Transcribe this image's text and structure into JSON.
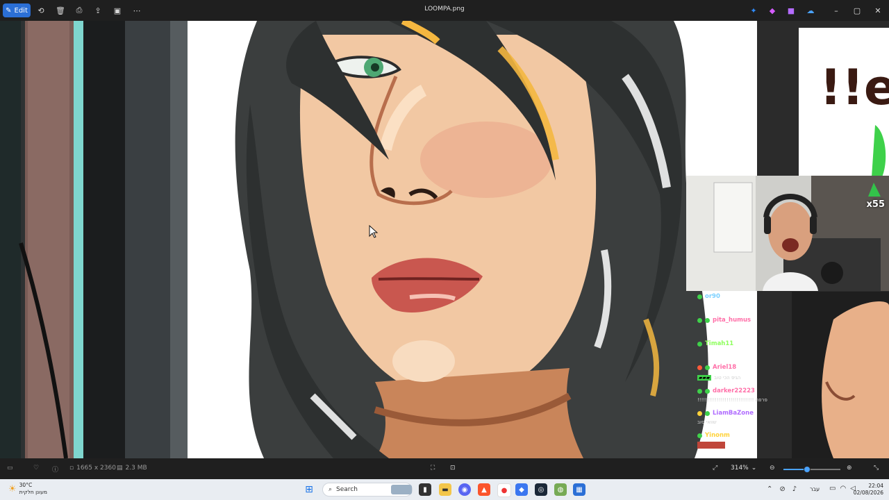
{
  "window": {
    "title": "LOOMPA.png",
    "edit_label": "Edit",
    "toolbar_icons": [
      "rotate-icon",
      "delete-icon",
      "print-icon",
      "share-icon",
      "slideshow-icon",
      "more-icon"
    ]
  },
  "overlay": {
    "streak_badge": "x55",
    "chat": [
      {
        "user": "or90",
        "color": "#7ad0ff",
        "text": ""
      },
      {
        "user": "pita_humus",
        "color": "#ff6fa8",
        "text": ""
      },
      {
        "user": "Timah11",
        "color": "#8cff5a",
        "text": ""
      },
      {
        "user": "Ariel18",
        "color": "#ff6fa8",
        "text": "הגיפ הכי טוב"
      },
      {
        "user": "darker22223",
        "color": "#ff6fa8",
        "text": "!!!!!!!!!!!!!!!!!!!!!!!!!!!!! פרפה"
      },
      {
        "user": "LiamBaZone",
        "color": "#b06cff",
        "text": "שוואי סוב"
      },
      {
        "user": "Yinonm",
        "color": "#ffd23a",
        "text": ""
      }
    ]
  },
  "statusbar": {
    "dimensions": "1665 x 2360",
    "filesize": "2.3 MB",
    "zoom": "314%",
    "zoom_fraction": 0.42
  },
  "taskbar": {
    "weather_temp": "30°C",
    "weather_text": "מעונן חלקית",
    "search_placeholder": "Search",
    "lang": "עבר",
    "time": "22:04",
    "date": "02/08/2026"
  }
}
